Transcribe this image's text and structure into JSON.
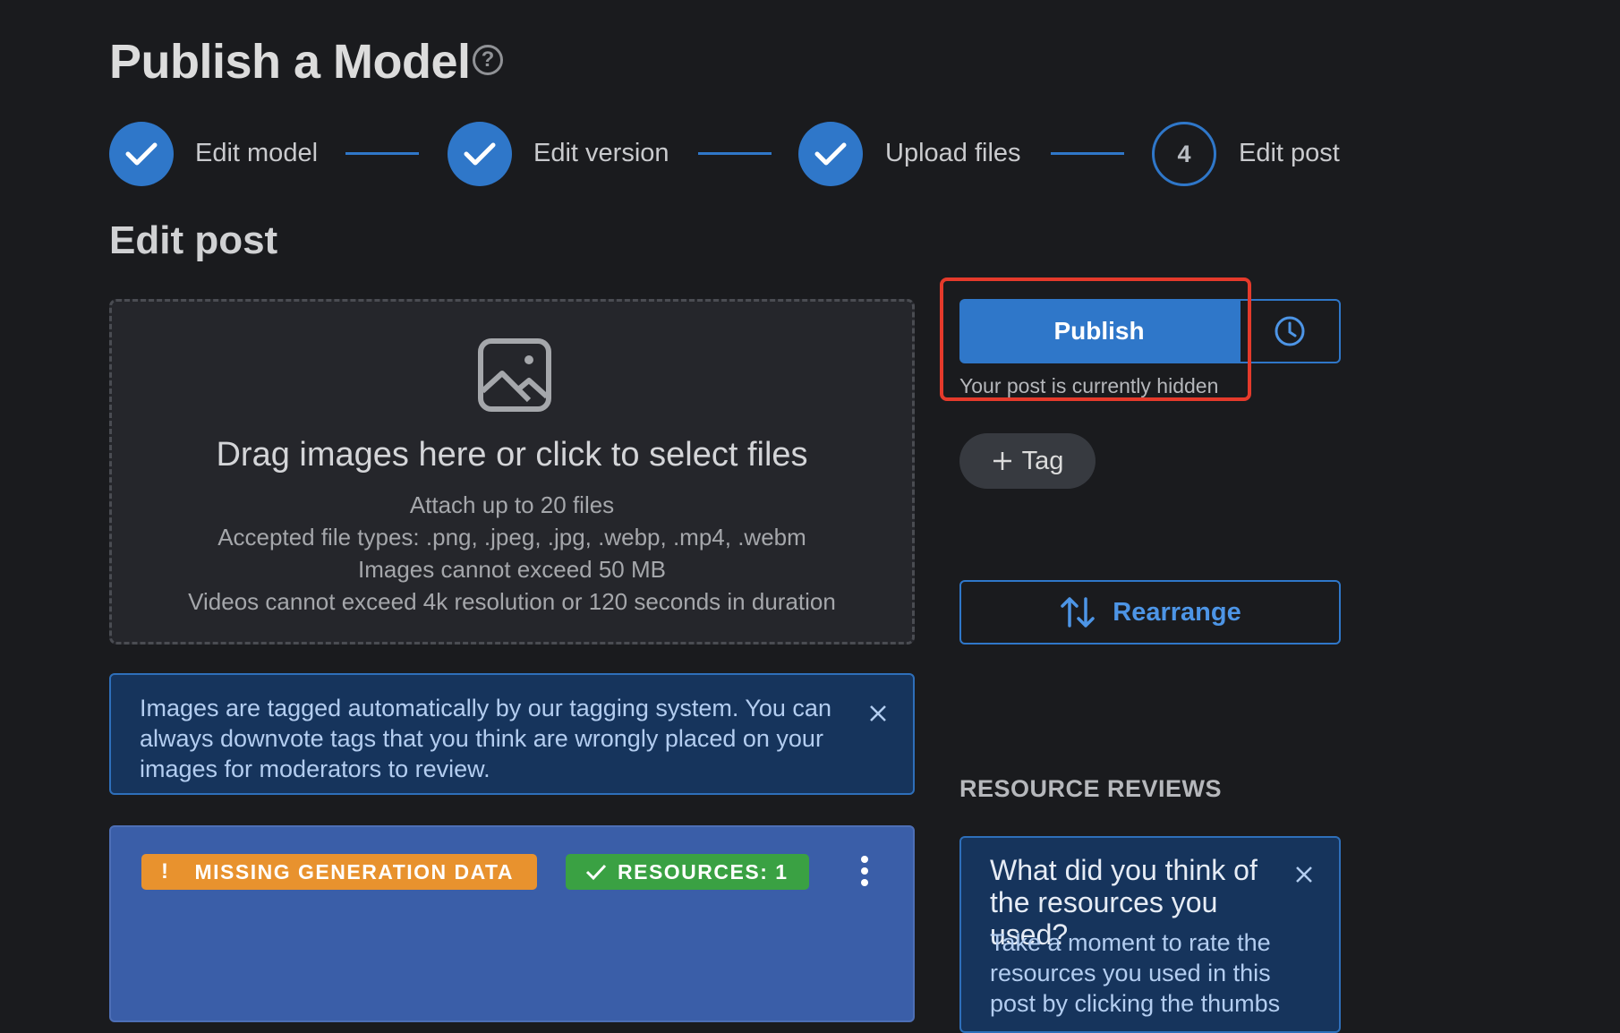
{
  "page": {
    "title": "Publish a Model",
    "help_icon": "question-circle-icon"
  },
  "stepper": {
    "steps": [
      {
        "label": "Edit model",
        "state": "completed",
        "icon": "check-icon"
      },
      {
        "label": "Edit version",
        "state": "completed",
        "icon": "check-icon"
      },
      {
        "label": "Upload files",
        "state": "completed",
        "icon": "check-icon"
      },
      {
        "label": "Edit post",
        "state": "current",
        "number": "4"
      }
    ]
  },
  "section_title": "Edit post",
  "dropzone": {
    "icon": "image-icon",
    "main_text": "Drag images here or click to select files",
    "lines": [
      "Attach up to 20 files",
      "Accepted file types: .png, .jpeg, .jpg, .webp, .mp4, .webm",
      "Images cannot exceed 50 MB",
      "Videos cannot exceed 4k resolution or 120 seconds in duration"
    ]
  },
  "info_alert": {
    "text": "Images are tagged automatically by our tagging system. You can always downvote tags that you think are wrongly placed on your images for moderators to review.",
    "close_icon": "close-icon"
  },
  "image_card": {
    "badges": [
      {
        "icon": "!",
        "label": "MISSING GENERATION DATA",
        "color": "#e8922e"
      },
      {
        "icon": "check-icon",
        "label": "RESOURCES: 1",
        "color": "#3aa143"
      }
    ],
    "menu_icon": "kebab-menu-icon"
  },
  "sidebar": {
    "publish_label": "Publish",
    "schedule_icon": "clock-icon",
    "hidden_text": "Your post is currently hidden",
    "tag_label": "Tag",
    "rearrange_label": "Rearrange",
    "reviews_title": "RESOURCE REVIEWS",
    "review_card": {
      "title": "What did you think of the resources you used?",
      "body": "Take a moment to rate the resources you used in this post by clicking the thumbs"
    }
  },
  "colors": {
    "background": "#1a1b1e",
    "accent": "#2f77c9",
    "highlight": "#e53a2b",
    "warning": "#e8922e",
    "success": "#3aa143"
  }
}
